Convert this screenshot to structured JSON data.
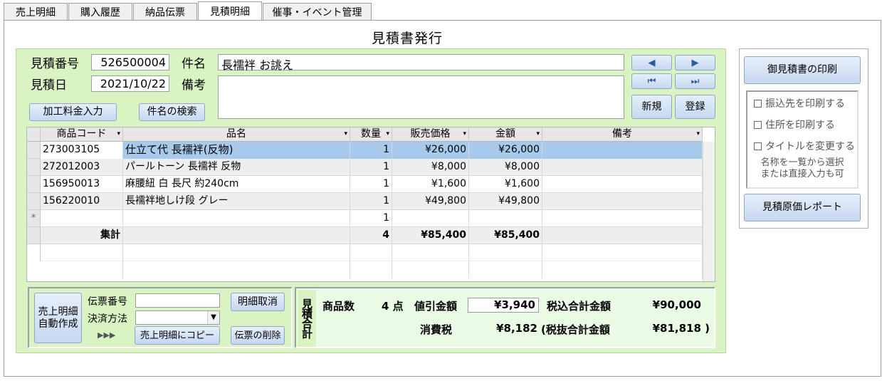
{
  "tabs": [
    "売上明細",
    "購入履歴",
    "納品伝票",
    "見積明細",
    "催事・イベント管理"
  ],
  "page_title": "見積書発行",
  "header": {
    "quote_no_label": "見積番号",
    "quote_no": "526500004",
    "subject_label": "件名",
    "subject": "長襦袢 お誂え",
    "quote_date_label": "見積日",
    "quote_date": "2021/10/22",
    "remarks_label": "備考",
    "remarks": "",
    "processing_fee_button": "加工料金入力",
    "subject_search_button": "件名の検索"
  },
  "nav": {
    "prev": "◀",
    "next": "▶",
    "first": "⏮",
    "last": "⏭",
    "new_label": "新規",
    "register_label": "登録"
  },
  "grid": {
    "columns": [
      "商品コード",
      "品名",
      "数量",
      "販売価格",
      "金額",
      "備考"
    ],
    "rows": [
      {
        "code": "273003105",
        "name": "仕立て代 長襦袢(反物)",
        "qty": "1",
        "price": "¥26,000",
        "amount": "¥26,000",
        "note": ""
      },
      {
        "code": "272012003",
        "name": "パールトーン 長襦袢 反物",
        "qty": "1",
        "price": "¥8,000",
        "amount": "¥8,000",
        "note": ""
      },
      {
        "code": "156950013",
        "name": "麻腰紐 白 長尺 約240cm",
        "qty": "1",
        "price": "¥1,600",
        "amount": "¥1,600",
        "note": ""
      },
      {
        "code": "156220010",
        "name": "長襦袢地しけ段 グレー",
        "qty": "1",
        "price": "¥49,800",
        "amount": "¥49,800",
        "note": ""
      }
    ],
    "new_row_marker": "*",
    "new_row_qty": "1",
    "total_label": "集計",
    "total_qty": "4",
    "total_price": "¥85,400",
    "total_amount": "¥85,400"
  },
  "bottom_left": {
    "auto_create_button": "売上明細\n自動作成",
    "slip_no_label": "伝票番号",
    "slip_no": "",
    "payment_label": "決済方法",
    "payment": "",
    "arrows": "▶▶▶",
    "copy_button": "売上明細にコピー",
    "cancel_detail_button": "明細取消",
    "delete_slip_button": "伝票の削除"
  },
  "summary": {
    "vertical_label": "見積合計",
    "item_count_label": "商品数",
    "item_count": "4 点",
    "discount_label": "値引金額",
    "discount": "¥3,940",
    "tax_incl_label": "税込合計金額",
    "tax_incl": "¥90,000",
    "tax_label": "消費税",
    "tax": "¥8,182",
    "tax_excl_label": "(税抜合計金額",
    "tax_excl": "¥81,818 )"
  },
  "side": {
    "print_button": "御見積書の印刷",
    "opt_transfer": "振込先を印刷する",
    "opt_address": "住所を印刷する",
    "opt_title": "タイトルを変更する",
    "hint_line1": "名称を一覧から選択",
    "hint_line2": "または直接入力も可",
    "cost_report_button": "見積原価レポート"
  }
}
